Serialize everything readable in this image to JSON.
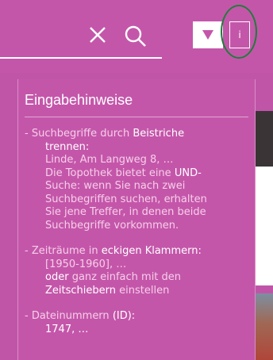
{
  "header": {
    "icons": {
      "close": "close-icon",
      "search": "search-icon",
      "dropdown": "triangle-down-icon"
    },
    "info_label": "i"
  },
  "hints": {
    "title": "Eingabehinweise",
    "sections": [
      {
        "intro": "- Suchbegriffe durch",
        "term": "Beistriche",
        "term2": "trennen:",
        "example": "Linde, Am Langweg 8, …",
        "expl_prefix": "Die Topothek bietet eine",
        "expl_highlight": "UND-",
        "expl_lines": [
          "Suche: wenn Sie nach zwei",
          "Suchbegriffen suchen, erhalten",
          "Sie jene Treffer, in denen beide",
          "Suchbegriffe vorkommen."
        ]
      },
      {
        "intro": "- Zeiträume in",
        "term": "eckigen Klammern:",
        "example": "[1950-1960], …",
        "or_word": "oder",
        "or_rest": "ganz einfach mit den",
        "tool": "Zeitschiebern",
        "tool_rest": "einstellen"
      },
      {
        "intro": "- Dateinummern",
        "term": "(ID):",
        "example": "1747, …"
      }
    ]
  }
}
